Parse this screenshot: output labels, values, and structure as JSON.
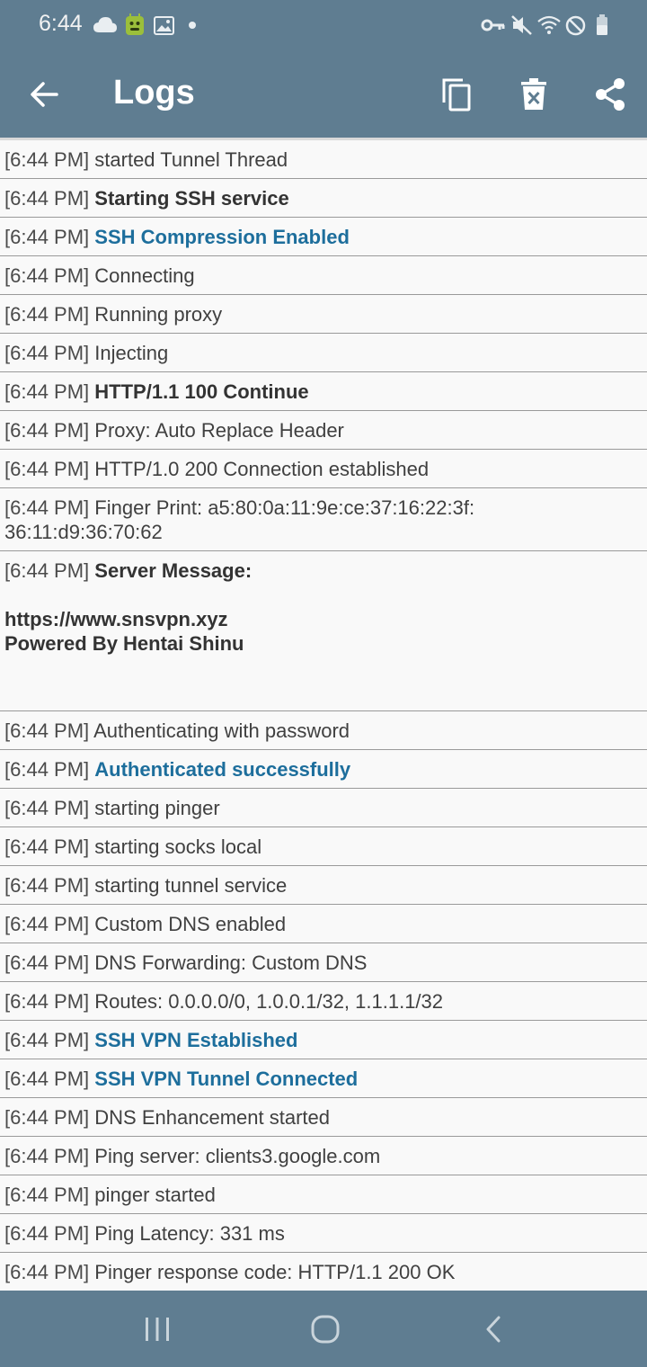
{
  "status_bar": {
    "time": "6:44",
    "left_icons": [
      "cloud-icon",
      "android-badge-icon",
      "image-icon",
      "dot-icon"
    ],
    "right_icons": [
      "vpn-key-icon",
      "mute-icon",
      "wifi-icon",
      "do-not-disturb-icon",
      "battery-icon"
    ]
  },
  "toolbar": {
    "title": "Logs",
    "actions": [
      "copy-icon",
      "delete-icon",
      "share-icon"
    ]
  },
  "colors": {
    "appbar": "#5f7d91",
    "accent": "#1d6e9c",
    "row_bg": "#f9f9f9",
    "divider": "#9a9a9a"
  },
  "logs": [
    {
      "time": "[6:44 PM]",
      "message": "started Tunnel Thread",
      "style": "normal"
    },
    {
      "time": "[6:44 PM]",
      "message": "Starting SSH service",
      "style": "bold"
    },
    {
      "time": "[6:44 PM]",
      "message": "SSH Compression Enabled",
      "style": "accent"
    },
    {
      "time": "[6:44 PM]",
      "message": "Connecting",
      "style": "normal"
    },
    {
      "time": "[6:44 PM]",
      "message": "Running proxy",
      "style": "normal"
    },
    {
      "time": "[6:44 PM]",
      "message": "Injecting",
      "style": "normal"
    },
    {
      "time": "[6:44 PM]",
      "message": "HTTP/1.1 100 Continue",
      "style": "bold"
    },
    {
      "time": "[6:44 PM]",
      "message": "Proxy: Auto Replace Header",
      "style": "normal"
    },
    {
      "time": "[6:44 PM]",
      "message": "HTTP/1.0 200 Connection established",
      "style": "normal"
    },
    {
      "time": "[6:44 PM]",
      "message": "Finger Print: a5:80:0a:11:9e:ce:37:16:22:3f:\n36:11:d9:36:70:62",
      "style": "normal"
    },
    {
      "time": "[6:44 PM]",
      "message": "Server Message:\n\nhttps://www.snsvpn.xyz\nPowered By Hentai Shinu",
      "style": "bold"
    },
    {
      "time": "[6:44 PM]",
      "message": "Authenticating with password",
      "style": "normal"
    },
    {
      "time": "[6:44 PM]",
      "message": "Authenticated successfully",
      "style": "accent"
    },
    {
      "time": "[6:44 PM]",
      "message": "starting pinger",
      "style": "normal"
    },
    {
      "time": "[6:44 PM]",
      "message": "starting socks local",
      "style": "normal"
    },
    {
      "time": "[6:44 PM]",
      "message": "starting tunnel service",
      "style": "normal"
    },
    {
      "time": "[6:44 PM]",
      "message": "Custom DNS enabled",
      "style": "normal"
    },
    {
      "time": "[6:44 PM]",
      "message": "DNS Forwarding: Custom DNS",
      "style": "normal"
    },
    {
      "time": "[6:44 PM]",
      "message": "Routes: 0.0.0.0/0, 1.0.0.1/32, 1.1.1.1/32",
      "style": "normal"
    },
    {
      "time": "[6:44 PM]",
      "message": "SSH VPN Established",
      "style": "accent"
    },
    {
      "time": "[6:44 PM]",
      "message": "SSH VPN Tunnel Connected",
      "style": "accent"
    },
    {
      "time": "[6:44 PM]",
      "message": "DNS Enhancement started",
      "style": "normal"
    },
    {
      "time": "[6:44 PM]",
      "message": "Ping server: clients3.google.com",
      "style": "normal"
    },
    {
      "time": "[6:44 PM]",
      "message": "pinger started",
      "style": "normal"
    },
    {
      "time": "[6:44 PM]",
      "message": "Ping Latency: 331 ms",
      "style": "normal"
    },
    {
      "time": "[6:44 PM]",
      "message": "Pinger response code: HTTP/1.1 200 OK",
      "style": "normal"
    }
  ],
  "nav_bar": {
    "buttons": [
      "recents-icon",
      "home-icon",
      "back-icon"
    ]
  }
}
